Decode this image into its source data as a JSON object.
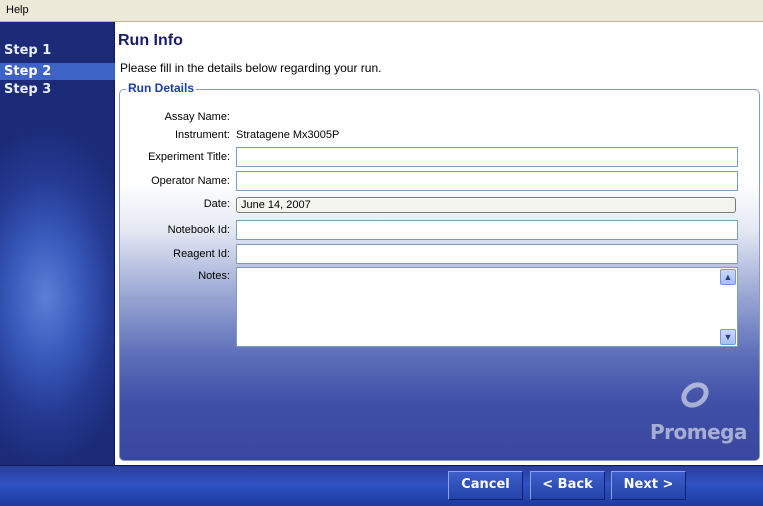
{
  "menubar": {
    "help": "Help"
  },
  "sidebar": {
    "steps": [
      "Step 1",
      "Step 2",
      "Step 3"
    ],
    "active_step": "Step 2"
  },
  "main": {
    "title": "Run Info",
    "subtitle": "Please fill in the details below regarding your run.",
    "panel_title": "Run Details",
    "fields": {
      "assay_name_label": "Assay Name:",
      "assay_name_value": "",
      "instrument_label": "Instrument:",
      "instrument_value": "Stratagene Mx3005P",
      "experiment_title_label": "Experiment Title:",
      "experiment_title_value": "",
      "operator_name_label": "Operator Name:",
      "operator_name_value": "",
      "date_label": "Date:",
      "date_value": "June 14, 2007",
      "notebook_id_label": "Notebook Id:",
      "notebook_id_value": "",
      "reagent_id_label": "Reagent Id:",
      "reagent_id_value": "",
      "notes_label": "Notes:",
      "notes_value": ""
    },
    "logo_text": "Promega"
  },
  "footer": {
    "cancel": "Cancel",
    "back": "< Back",
    "next": "Next >"
  }
}
